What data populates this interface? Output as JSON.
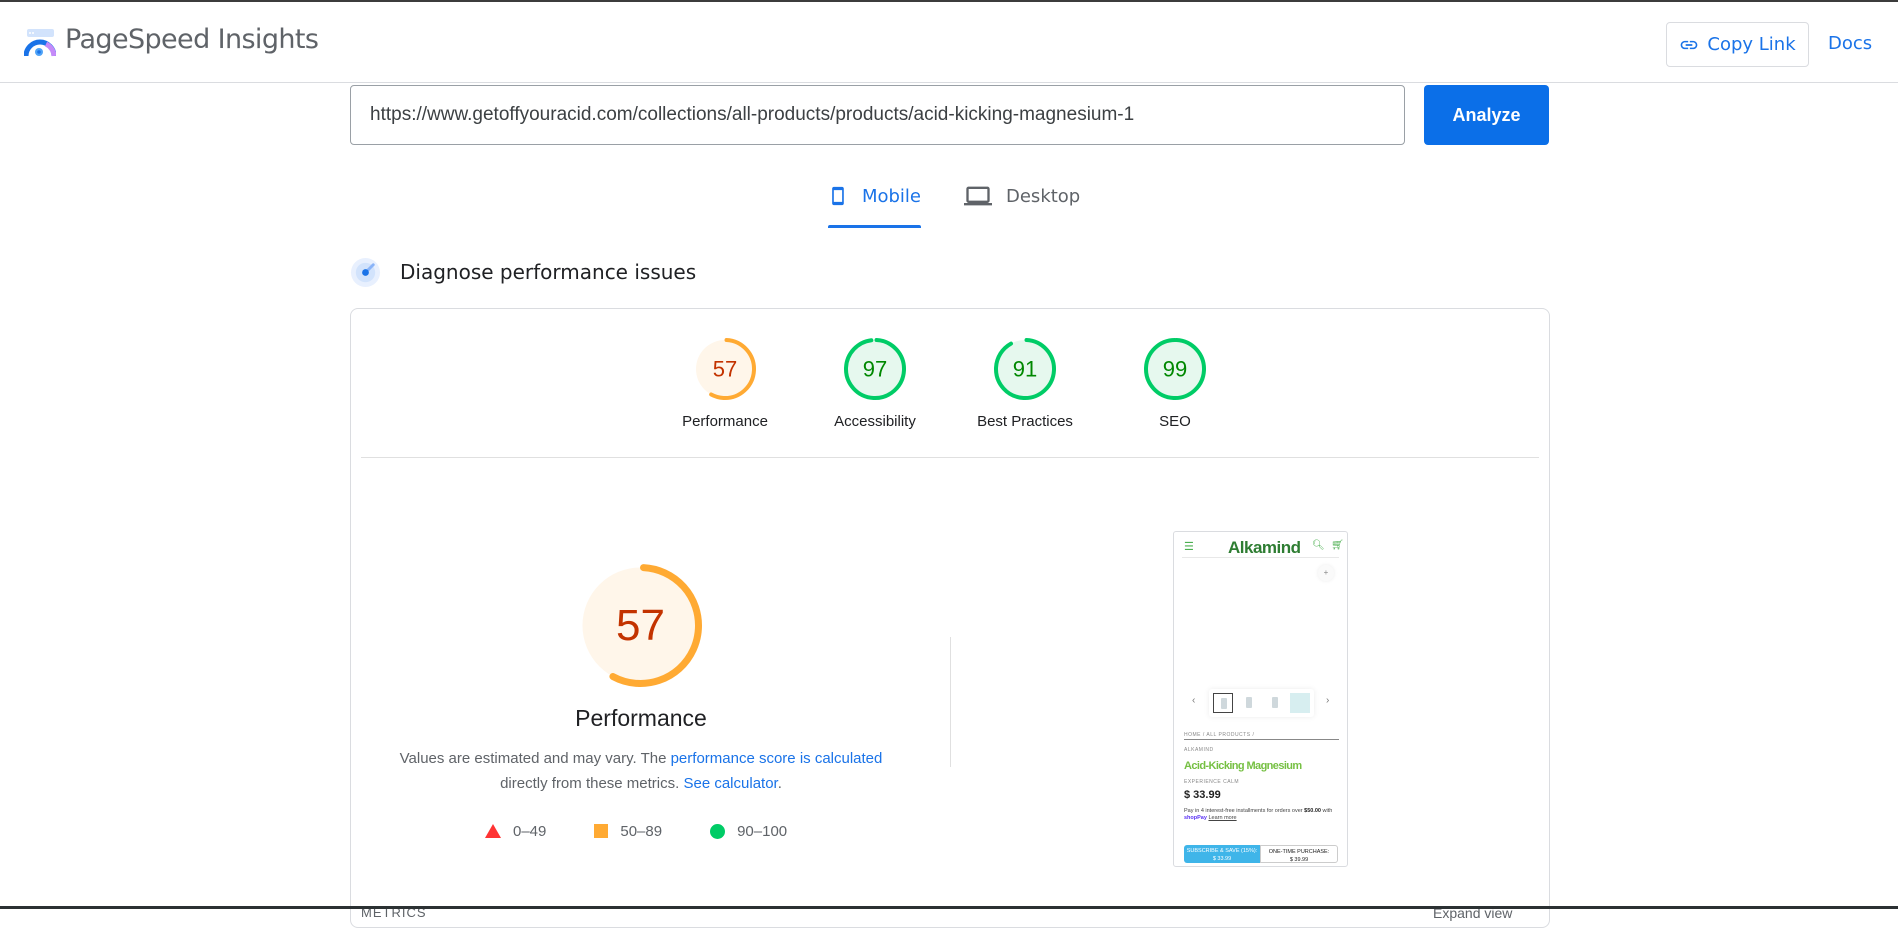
{
  "app": {
    "title": "PageSpeed Insights",
    "logo_icon": "pagespeed-gauge-icon"
  },
  "header": {
    "copy_link_label": "Copy Link",
    "copy_link_icon": "link-icon",
    "docs_label": "Docs"
  },
  "search": {
    "url_value": "https://www.getoffyouracid.com/collections/all-products/products/acid-kicking-magnesium-1",
    "analyze_label": "Analyze"
  },
  "tabs": [
    {
      "label": "Mobile",
      "icon": "smartphone-icon",
      "active": true
    },
    {
      "label": "Desktop",
      "icon": "laptop-icon",
      "active": false
    }
  ],
  "diagnose": {
    "title": "Diagnose performance issues",
    "icon": "radar-icon"
  },
  "colors": {
    "fail": "#ff3333",
    "average": "#ffaa33",
    "pass": "#00cc66",
    "average_text": "#c33300",
    "pass_text": "#008800",
    "accent": "#1a73e8"
  },
  "scores": [
    {
      "label": "Performance",
      "value": 57,
      "rating": "average"
    },
    {
      "label": "Accessibility",
      "value": 97,
      "rating": "pass"
    },
    {
      "label": "Best Practices",
      "value": 91,
      "rating": "pass"
    },
    {
      "label": "SEO",
      "value": 99,
      "rating": "pass"
    }
  ],
  "performance": {
    "score": 57,
    "label": "Performance",
    "note_prefix": "Values are estimated and may vary. The ",
    "note_link1": "performance score is calculated",
    "note_middle": " directly from these metrics. ",
    "note_link2": "See calculator",
    "note_suffix": "."
  },
  "legend": [
    {
      "shape": "triangle",
      "range": "0–49"
    },
    {
      "shape": "square",
      "range": "50–89"
    },
    {
      "shape": "circle",
      "range": "90–100"
    }
  ],
  "screenshot_preview": {
    "brand": "Alkamind",
    "breadcrumb": "HOME / ALL PRODUCTS /",
    "vendor": "ALKAMIND",
    "product_title": "Acid-Kicking Magnesium",
    "subtitle": "EXPERIENCE CALM",
    "price": "$ 33.99",
    "pay_text_prefix": "Pay in 4 interest-free installments for orders over ",
    "pay_threshold": "$50.00",
    "pay_with": " with ",
    "pay_brand": "shopPay",
    "pay_learn": "Learn more",
    "subscribe_label": "SUBSCRIBE & SAVE (15%):",
    "subscribe_price": "$ 33.99",
    "onetime_label": "ONE-TIME PURCHASE:",
    "onetime_price": "$ 39.99"
  },
  "footer_partial": {
    "metrics_label": "METRICS",
    "expand_label": "Expand view"
  }
}
